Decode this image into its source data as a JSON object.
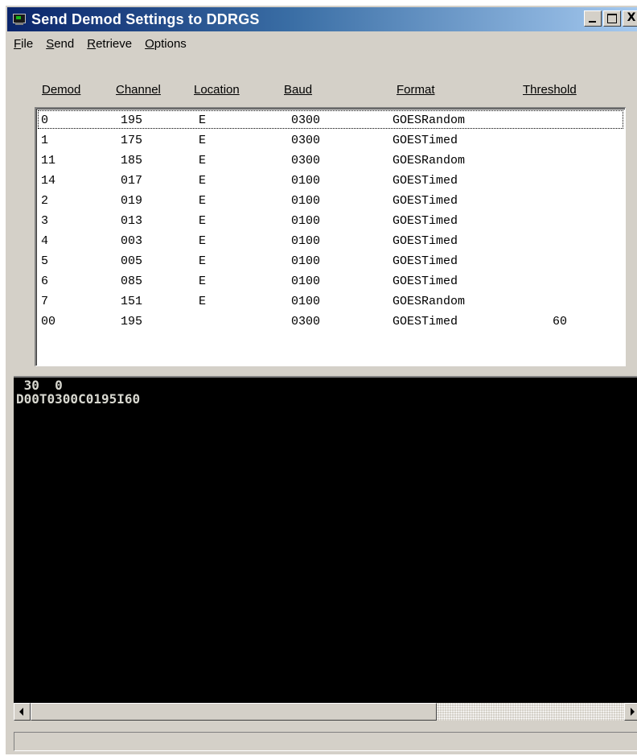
{
  "window": {
    "title": "Send Demod Settings to DDRGS",
    "min_glyph": "",
    "max_glyph": "",
    "close_glyph": "X"
  },
  "menu": [
    {
      "accel": "F",
      "rest": "ile"
    },
    {
      "accel": "S",
      "rest": "end"
    },
    {
      "accel": "R",
      "rest": "etrieve"
    },
    {
      "accel": "O",
      "rest": "ptions"
    }
  ],
  "columns": [
    "Demod",
    "Channel",
    "Location",
    "Baud",
    "Format",
    "Threshold"
  ],
  "rows": [
    {
      "demod": "0",
      "channel": "195",
      "location": "E",
      "baud": "0300",
      "format": "GOESRandom",
      "threshold": ""
    },
    {
      "demod": "1",
      "channel": "175",
      "location": "E",
      "baud": "0300",
      "format": "GOESTimed",
      "threshold": ""
    },
    {
      "demod": "11",
      "channel": "185",
      "location": "E",
      "baud": "0300",
      "format": "GOESRandom",
      "threshold": ""
    },
    {
      "demod": "14",
      "channel": "017",
      "location": "E",
      "baud": "0100",
      "format": "GOESTimed",
      "threshold": ""
    },
    {
      "demod": "2",
      "channel": "019",
      "location": "E",
      "baud": "0100",
      "format": "GOESTimed",
      "threshold": ""
    },
    {
      "demod": "3",
      "channel": "013",
      "location": "E",
      "baud": "0100",
      "format": "GOESTimed",
      "threshold": ""
    },
    {
      "demod": "4",
      "channel": "003",
      "location": "E",
      "baud": "0100",
      "format": "GOESTimed",
      "threshold": ""
    },
    {
      "demod": "5",
      "channel": "005",
      "location": "E",
      "baud": "0100",
      "format": "GOESTimed",
      "threshold": ""
    },
    {
      "demod": "6",
      "channel": "085",
      "location": "E",
      "baud": "0100",
      "format": "GOESTimed",
      "threshold": ""
    },
    {
      "demod": "7",
      "channel": "151",
      "location": "E",
      "baud": "0100",
      "format": "GOESRandom",
      "threshold": ""
    },
    {
      "demod": "00",
      "channel": "195",
      "location": "",
      "baud": "0300",
      "format": "GOESTimed",
      "threshold": "60"
    }
  ],
  "selected_row": 0,
  "console": {
    "lines": [
      " 30  0",
      "D00T0300C0195I60"
    ]
  },
  "statusbar": {
    "text": ""
  },
  "colors": {
    "titlebar_start": "#0a246a",
    "titlebar_end": "#a6caf0",
    "face": "#d4d0c8",
    "console_bg": "#000000",
    "console_fg": "#d8d8d0"
  }
}
